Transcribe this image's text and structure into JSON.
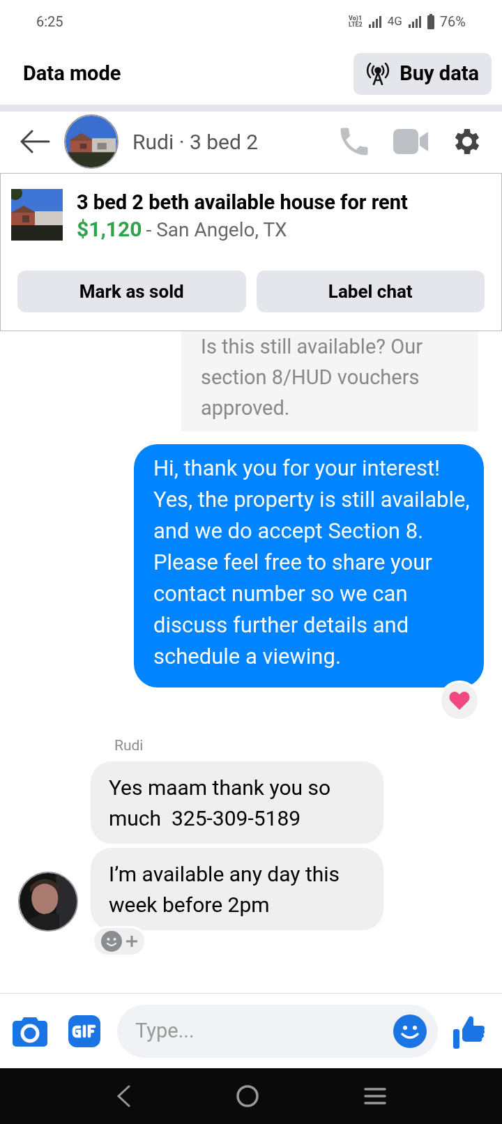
{
  "status_bar": {
    "time": "6:25",
    "volte_top": "Vo)1",
    "volte_bottom": "LTE2",
    "network": "4G",
    "battery": "76%"
  },
  "data_banner": {
    "title": "Data mode",
    "button": "Buy data"
  },
  "chat_header": {
    "title": "Rudi · 3 bed 2"
  },
  "listing": {
    "title": "3 bed 2 beth available house for rent",
    "price": "$1,120",
    "location": "- San Angelo, TX",
    "buttons": [
      "Mark as sold",
      "Label chat"
    ]
  },
  "messages": [
    {
      "kind": "outgoing_faded",
      "text": "Is this still available? Our section 8/HUD vouchers approved."
    },
    {
      "kind": "outgoing",
      "text": "Hi, thank you for your interest! Yes, the property is still available, and we do accept Section 8. Please feel free to share your contact number so we can discuss further details and schedule a viewing.",
      "heart_reaction": true
    },
    {
      "kind": "sender",
      "text": "Rudi"
    },
    {
      "kind": "incoming",
      "text": "Yes maam thank you so much  325-309-5189"
    },
    {
      "kind": "incoming",
      "text": "I’m available any day this week before 2pm",
      "avatar": true,
      "add_reaction": true
    }
  ],
  "composer": {
    "placeholder": "Type..."
  }
}
